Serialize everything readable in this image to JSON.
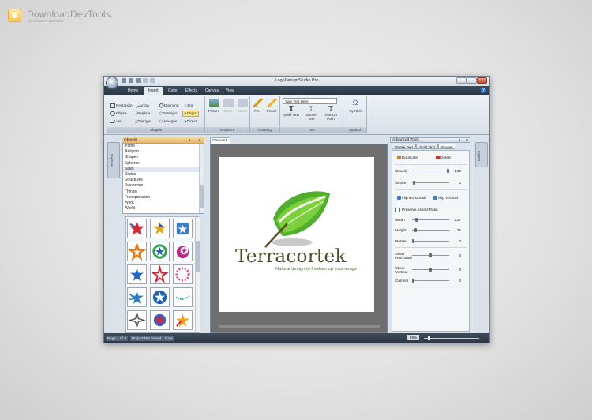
{
  "watermark": {
    "title": "DownloadDevTools.",
    "subtitle": "developer's paradise"
  },
  "window": {
    "title": "LogoDesignStudio Pro"
  },
  "menu": {
    "tabs": [
      "Home",
      "Insert",
      "Color",
      "Effects",
      "Canvas",
      "View"
    ],
    "active": "Insert",
    "help": "?"
  },
  "ribbon": {
    "shapes": {
      "items": [
        "Rectangle",
        "Arrow",
        "Diamond",
        "Star",
        "Ellipse",
        "Polyline",
        "Pentagon",
        "Object",
        "Line",
        "Triangle",
        "Hexagon",
        "Direct"
      ],
      "selected": "Object",
      "label": "Shapes"
    },
    "graphics": {
      "items": [
        "Picture",
        "Crop",
        "Select"
      ],
      "label": "Graphics"
    },
    "drawing": {
      "items": [
        "Pen",
        "Pencil"
      ],
      "label": "Drawing"
    },
    "text": {
      "input_value": "Your Text Here",
      "items": [
        "Solid Text",
        "Stroke Text",
        "Text On Path"
      ],
      "label": "Text"
    },
    "symbol": {
      "items": [
        "Symbol"
      ],
      "label": "Symbol"
    }
  },
  "left_panel": {
    "side_tab": "Explorer",
    "title": "Objects",
    "title_buttons": [
      "▾",
      "✕"
    ],
    "list": [
      "Paths",
      "Religion",
      "Shapes",
      "Spheres",
      "Stars",
      "States",
      "Structures",
      "Swooshes",
      "Things",
      "Transportation",
      "Work",
      "World"
    ],
    "selected": "Stars"
  },
  "canvas": {
    "tab": "Canvas1",
    "logo": {
      "name": "Terracortek",
      "tagline": "Natural design to freshen up your image"
    }
  },
  "advanced": {
    "title": "Advanced Tools",
    "tabs": [
      "Stroke Text",
      "Solid Text",
      "Shapes"
    ],
    "active_tab": "Shapes",
    "buttons": {
      "duplicate": "Duplicate",
      "delete": "Delete",
      "flip_h": "Flip Horizontal",
      "flip_v": "Flip Vertical"
    },
    "preserve": "Preserve Aspect Ratio",
    "props": [
      {
        "label": "Opacity",
        "value": "100",
        "level": 1.0
      },
      {
        "label": "Stroke",
        "value": "2",
        "level": 0.02
      },
      {
        "label": "Width",
        "value": "127",
        "level": 0.1
      },
      {
        "label": "Height",
        "value": "75",
        "level": 0.06
      },
      {
        "label": "Rotate",
        "value": "0",
        "level": 0.0
      },
      {
        "label": "Skew Horizontal",
        "value": "0",
        "level": 0.5
      },
      {
        "label": "Skew Vertical",
        "value": "0",
        "level": 0.5
      },
      {
        "label": "Corners",
        "value": "0",
        "level": 0.0
      }
    ]
  },
  "layers_tab": "Layers",
  "status": {
    "page": "Page 1 of 1",
    "saved": "Project Not Saved",
    "date": "Date",
    "zoom": "28%"
  }
}
